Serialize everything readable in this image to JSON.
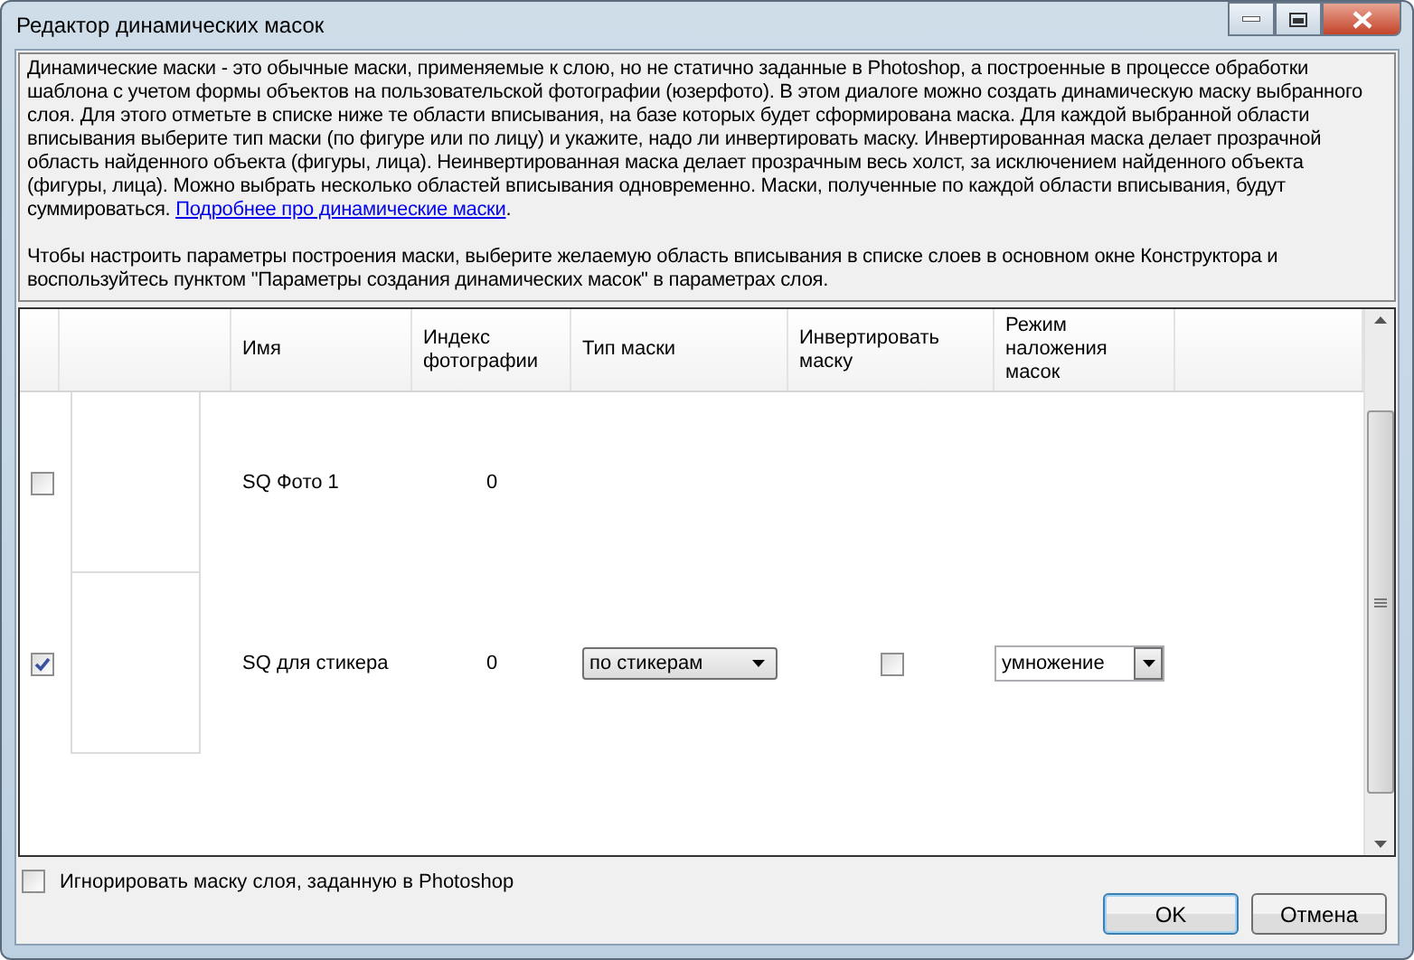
{
  "window": {
    "title": "Редактор динамических масок"
  },
  "description": {
    "text": "Динамические маски - это обычные маски, применяемые к слою, но не статично заданные в Photoshop, а построенные в процессе обработки шаблона с учетом формы объектов на пользовательской фотографии (юзерфото). В этом диалоге можно создать динамическую маску выбранного слоя. Для этого отметьте в списке ниже те области вписывания, на базе которых будет сформирована маска. Для каждой выбранной области вписывания выберите тип маски (по фигуре или по лицу) и укажите, надо ли инвертировать маску. Инвертированная маска делает прозрачной область найденного объекта (фигуры, лица). Неинвертированная маска делает прозрачным весь холст, за исключением найденного объекта (фигуры, лица). Можно выбрать несколько областей вписывания одновременно. Маски, полученные по каждой области вписывания, будут суммироваться. ",
    "link": "Подробнее про динамические маски",
    "after": ".",
    "note": "Чтобы настроить параметры построения маски, выберите желаемую область вписывания в списке слоев в основном окне Конструктора и воспользуйтесь пунктом \"Параметры создания динамических масок\" в параметрах слоя."
  },
  "table": {
    "columns": [
      "Имя",
      "Индекс фотографии",
      "Тип маски",
      "Инвертировать маску",
      "Режим наложения масок"
    ],
    "rows": [
      {
        "checked": false,
        "name": "SQ Фото 1",
        "index": "0"
      },
      {
        "checked": true,
        "name": "SQ для стикера",
        "index": "0",
        "mask_type": "по стикерам",
        "invert": false,
        "blend_mode": "умножение"
      }
    ]
  },
  "ignore_mask": {
    "label": "Игнорировать маску слоя, заданную в Photoshop",
    "checked": false
  },
  "buttons": [
    {
      "label": "OK",
      "default": true
    },
    {
      "label": "Отмена",
      "default": false
    }
  ]
}
